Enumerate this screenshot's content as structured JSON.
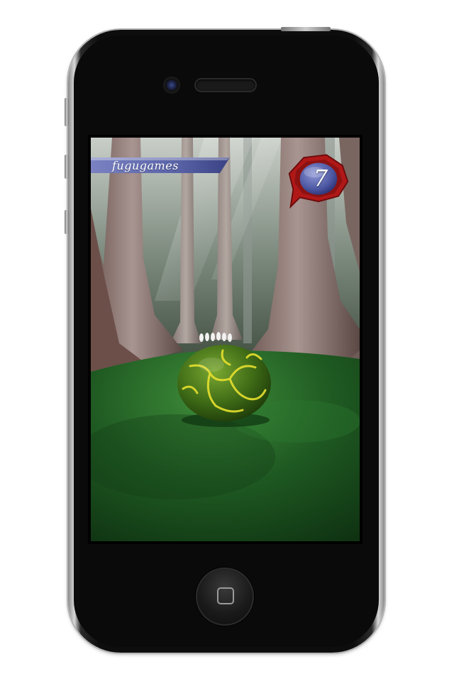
{
  "game": {
    "brand": "fugugames",
    "counter": "7"
  },
  "icons": {
    "home": "home-button-icon",
    "camera": "front-camera-icon",
    "speaker": "earpiece-speaker-icon",
    "badge": "score-badge-icon"
  },
  "colors": {
    "felt_green": "#1f5a22",
    "ball_green": "#4a7a1a",
    "ball_veins": "#e8e830",
    "badge_red": "#b01818",
    "badge_blue": "#4a55a0",
    "banner_blue": "#5a64a8"
  }
}
